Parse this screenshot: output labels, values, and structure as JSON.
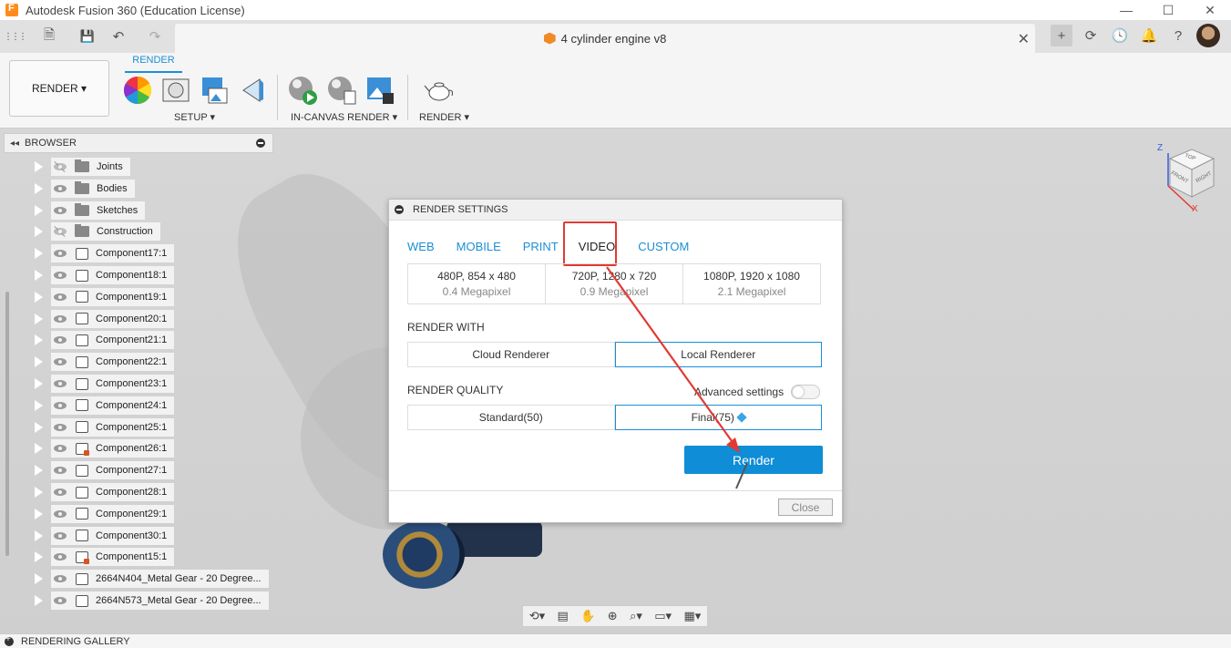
{
  "app": {
    "title": "Autodesk Fusion 360 (Education License)",
    "window_controls": [
      "—",
      "☐",
      "✕"
    ]
  },
  "document": {
    "tab_name": "4 cylinder engine v8",
    "close_glyph": "✕"
  },
  "qat": {
    "grid_icon": "⋮⋮⋮",
    "file_icon": "🗎",
    "save_icon": "💾",
    "undo_icon": "↶",
    "redo_icon": "↷",
    "plus_icon": "+",
    "right_icons": [
      "⟳",
      "🕓",
      "🔔",
      "?"
    ]
  },
  "ribbon": {
    "workspace_label": "RENDER ▾",
    "active_tab": "RENDER",
    "groups": [
      {
        "label": "SETUP ▾"
      },
      {
        "label": "IN-CANVAS RENDER ▾"
      },
      {
        "label": "RENDER ▾"
      }
    ]
  },
  "browser": {
    "title": "BROWSER",
    "collapse_glyph": "◂◂",
    "items": [
      {
        "label": "Joints",
        "kind": "folder",
        "visible": false
      },
      {
        "label": "Bodies",
        "kind": "folder",
        "visible": true
      },
      {
        "label": "Sketches",
        "kind": "folder",
        "visible": true
      },
      {
        "label": "Construction",
        "kind": "folder",
        "visible": false
      },
      {
        "label": "Component17:1",
        "kind": "component",
        "visible": true
      },
      {
        "label": "Component18:1",
        "kind": "component",
        "visible": true
      },
      {
        "label": "Component19:1",
        "kind": "component",
        "visible": true
      },
      {
        "label": "Component20:1",
        "kind": "component",
        "visible": true
      },
      {
        "label": "Component21:1",
        "kind": "component",
        "visible": true
      },
      {
        "label": "Component22:1",
        "kind": "component",
        "visible": true
      },
      {
        "label": "Component23:1",
        "kind": "component",
        "visible": true
      },
      {
        "label": "Component24:1",
        "kind": "component",
        "visible": true
      },
      {
        "label": "Component25:1",
        "kind": "component",
        "visible": true
      },
      {
        "label": "Component26:1",
        "kind": "component-ref",
        "visible": true
      },
      {
        "label": "Component27:1",
        "kind": "component",
        "visible": true
      },
      {
        "label": "Component28:1",
        "kind": "component",
        "visible": true
      },
      {
        "label": "Component29:1",
        "kind": "component",
        "visible": true
      },
      {
        "label": "Component30:1",
        "kind": "component",
        "visible": true
      },
      {
        "label": "Component15:1",
        "kind": "component-ref",
        "visible": true
      },
      {
        "label": "2664N404_Metal Gear - 20 Degree...",
        "kind": "component",
        "visible": true
      },
      {
        "label": "2664N573_Metal Gear - 20 Degree...",
        "kind": "component",
        "visible": true
      }
    ]
  },
  "dialog": {
    "title": "RENDER SETTINGS",
    "tabs": [
      "WEB",
      "MOBILE",
      "PRINT",
      "VIDEO",
      "CUSTOM"
    ],
    "active_tab": "VIDEO",
    "resolutions": [
      {
        "main": "480P, 854 x 480",
        "sub": "0.4 Megapixel"
      },
      {
        "main": "720P, 1280 x 720",
        "sub": "0.9 Megapixel"
      },
      {
        "main": "1080P, 1920 x 1080",
        "sub": "2.1 Megapixel"
      }
    ],
    "render_with_label": "RENDER WITH",
    "render_with_options": [
      "Cloud Renderer",
      "Local Renderer"
    ],
    "render_with_selected": "Local Renderer",
    "render_quality_label": "RENDER QUALITY",
    "advanced_label": "Advanced settings",
    "quality_options": [
      "Standard(50)",
      "Final(75)"
    ],
    "quality_selected": "Final(75)",
    "render_button": "Render",
    "close_button": "Close"
  },
  "viewcube": {
    "z": "Z",
    "x": "X",
    "top": "TOP",
    "front": "FRONT",
    "right": "RIGHT"
  },
  "gallery": {
    "label": "RENDERING GALLERY"
  },
  "colors": {
    "accent": "#1a8fd6",
    "render_button": "#0f8dd6",
    "annotation": "#e23a32"
  }
}
